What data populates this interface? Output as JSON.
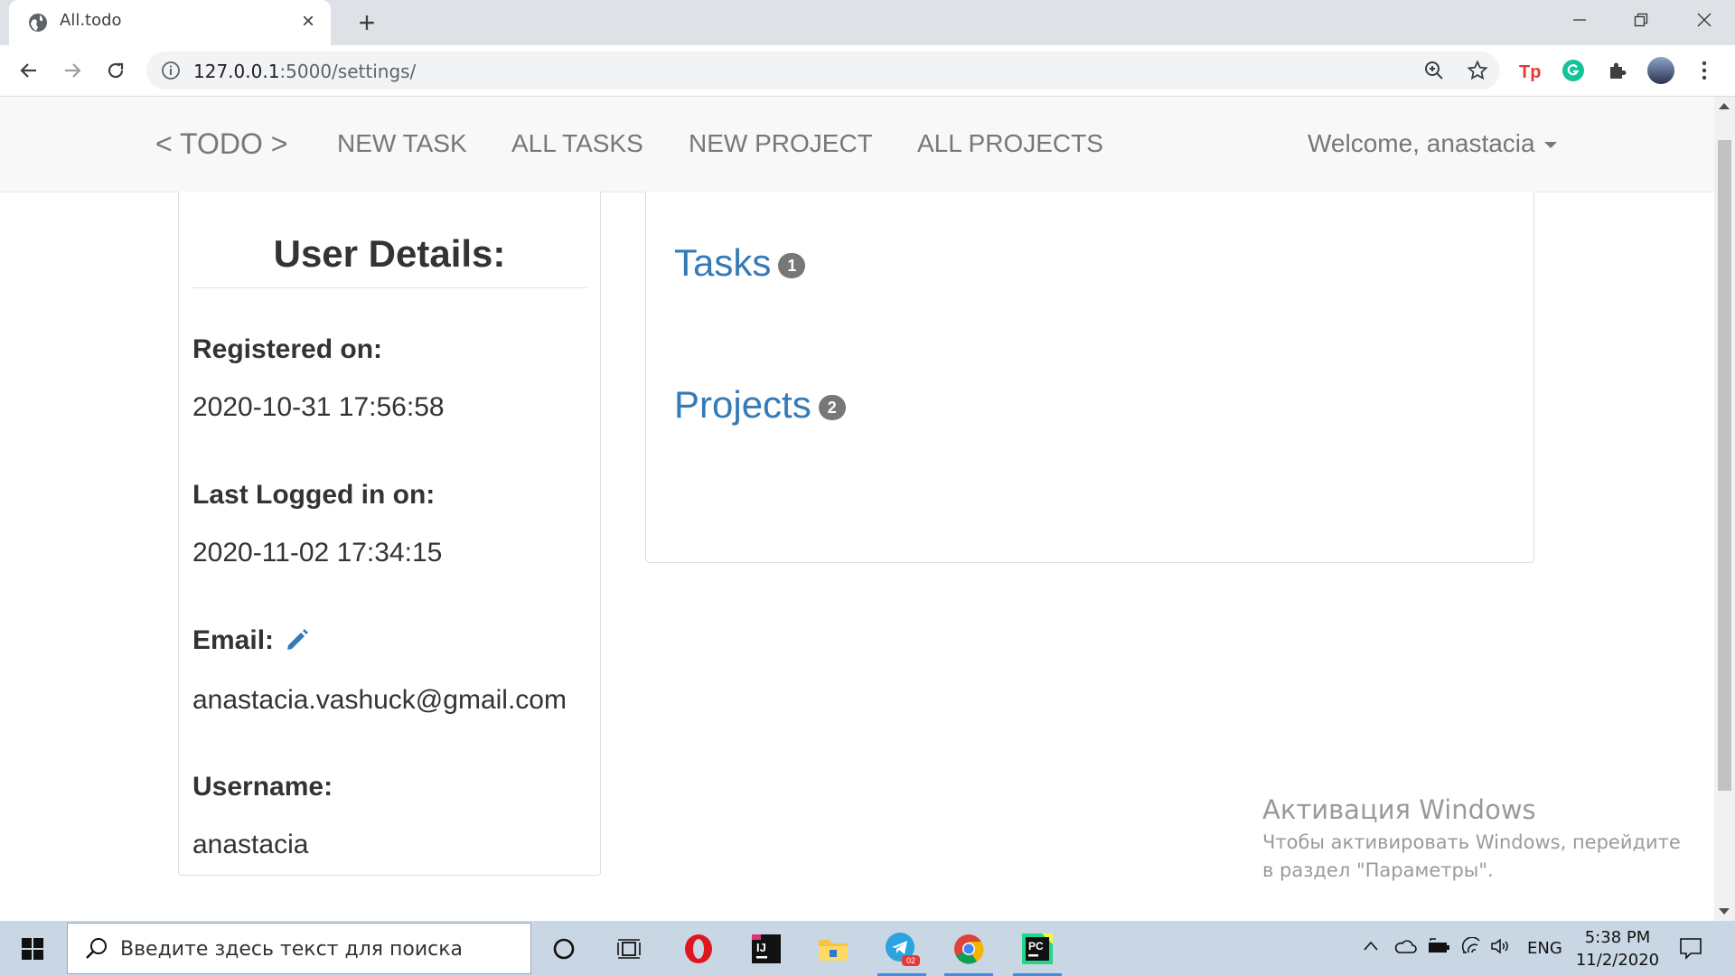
{
  "browser": {
    "tab_title": "All.todo",
    "url_host": "127.0.0.1",
    "url_rest": ":5000/settings/"
  },
  "navbar": {
    "brand": "< TODO >",
    "links": [
      "NEW TASK",
      "ALL TASKS",
      "NEW PROJECT",
      "ALL PROJECTS"
    ],
    "welcome": "Welcome, anastacia"
  },
  "user_details": {
    "title": "User Details:",
    "registered_label": "Registered on:",
    "registered_value": "2020-10-31 17:56:58",
    "last_login_label": "Last Logged in on:",
    "last_login_value": "2020-11-02 17:34:15",
    "email_label": "Email:",
    "email_value": "anastacia.vashuck@gmail.com",
    "username_label": "Username:",
    "username_value": "anastacia"
  },
  "stats": {
    "tasks_label": "Tasks",
    "tasks_count": "1",
    "projects_label": "Projects",
    "projects_count": "2"
  },
  "watermark": {
    "title": "Активация Windows",
    "body": "Чтобы активировать Windows, перейдите в раздел \"Параметры\"."
  },
  "taskbar": {
    "search_placeholder": "Введите здесь текст для поиска",
    "language": "ENG",
    "time": "5:38 PM",
    "date": "11/2/2020",
    "telegram_badge": "02"
  },
  "colors": {
    "link": "#337ab7",
    "navbar_bg": "#f8f8f8",
    "badge": "#777777"
  }
}
